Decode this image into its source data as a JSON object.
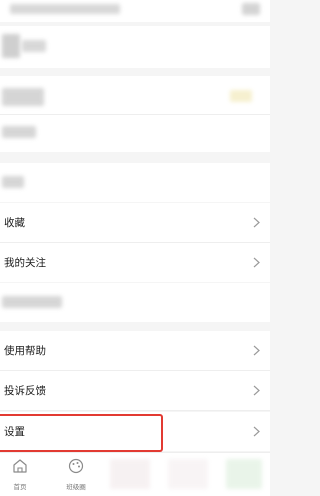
{
  "rows": {
    "favorites": "收藏",
    "my_follows": "我的关注",
    "help": "使用帮助",
    "feedback": "投诉反馈",
    "settings": "设置"
  },
  "tabbar": {
    "home": "首页",
    "class_circle": "班级圈"
  },
  "colors": {
    "highlight_border": "#e23a32",
    "background": "#f5f5f5",
    "row_background": "#ffffff"
  },
  "icons": {
    "row_arrow": "chevron-right-icon",
    "home": "home-icon",
    "class_circle": "palette-icon"
  }
}
